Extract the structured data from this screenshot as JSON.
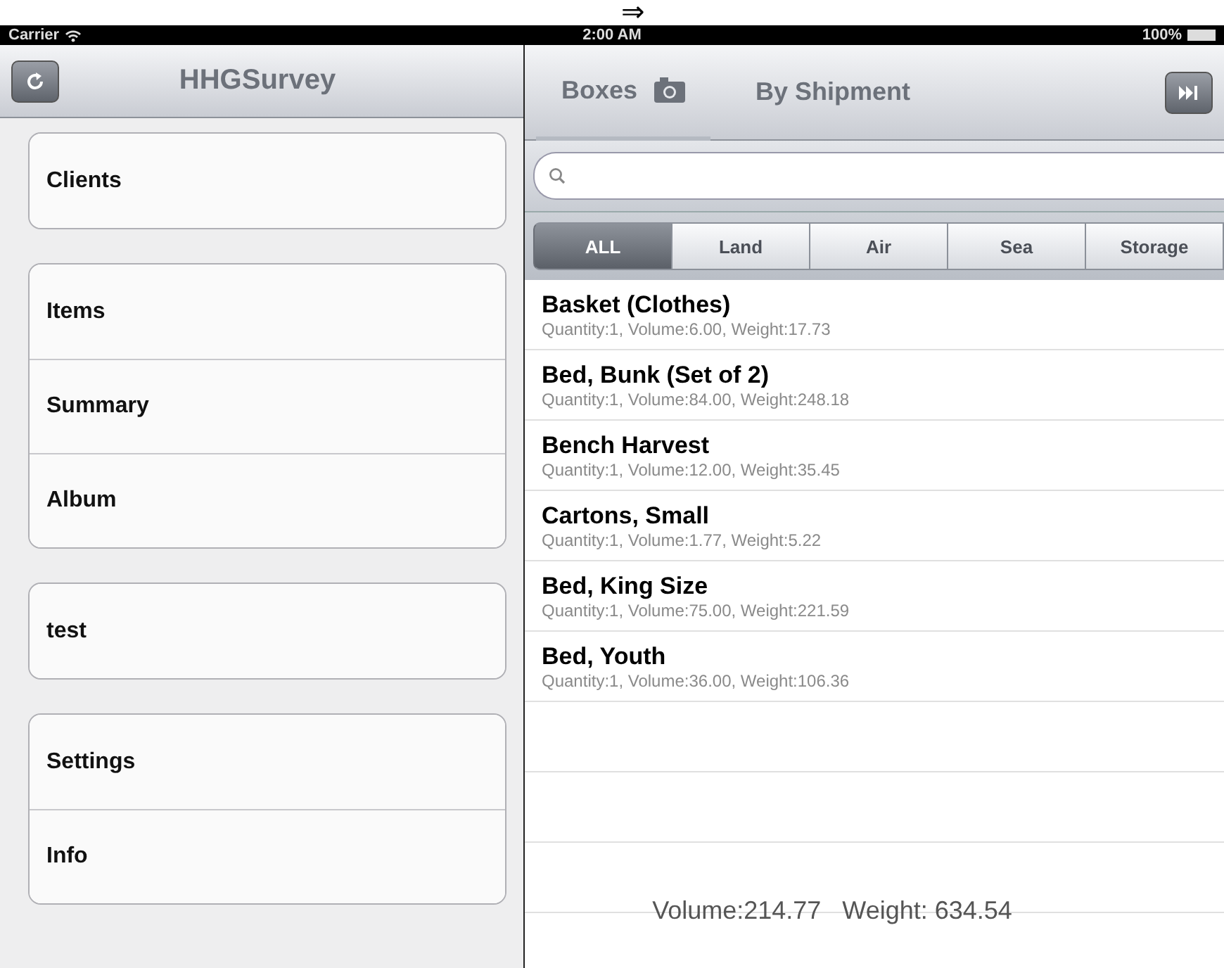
{
  "top_mark": "⇒",
  "status_bar": {
    "carrier": "Carrier",
    "time": "2:00 AM",
    "battery": "100%"
  },
  "sidebar": {
    "title": "HHGSurvey",
    "groups": [
      {
        "items": [
          {
            "label": "Clients"
          }
        ]
      },
      {
        "items": [
          {
            "label": "Items"
          },
          {
            "label": "Summary"
          },
          {
            "label": "Album"
          }
        ]
      },
      {
        "items": [
          {
            "label": "test"
          }
        ]
      },
      {
        "items": [
          {
            "label": "Settings"
          },
          {
            "label": "Info"
          }
        ]
      }
    ]
  },
  "main": {
    "tabs": [
      {
        "label": "Boxes",
        "selected": true
      },
      {
        "label": "By Shipment",
        "selected": false
      }
    ],
    "filters": [
      {
        "label": "ALL",
        "selected": true
      },
      {
        "label": "Land",
        "selected": false
      },
      {
        "label": "Air",
        "selected": false
      },
      {
        "label": "Sea",
        "selected": false
      },
      {
        "label": "Storage",
        "selected": false
      }
    ],
    "items": [
      {
        "name": "Basket (Clothes)",
        "details": "Quantity:1, Volume:6.00, Weight:17.73"
      },
      {
        "name": "Bed, Bunk (Set of 2)",
        "details": "Quantity:1, Volume:84.00, Weight:248.18"
      },
      {
        "name": "Bench Harvest",
        "details": "Quantity:1, Volume:12.00, Weight:35.45"
      },
      {
        "name": "Cartons, Small",
        "details": "Quantity:1, Volume:1.77, Weight:5.22"
      },
      {
        "name": "Bed, King Size",
        "details": "Quantity:1, Volume:75.00, Weight:221.59"
      },
      {
        "name": "Bed, Youth",
        "details": "Quantity:1, Volume:36.00, Weight:106.36"
      }
    ],
    "totals": "Volume:214.77   Weight: 634.54"
  }
}
